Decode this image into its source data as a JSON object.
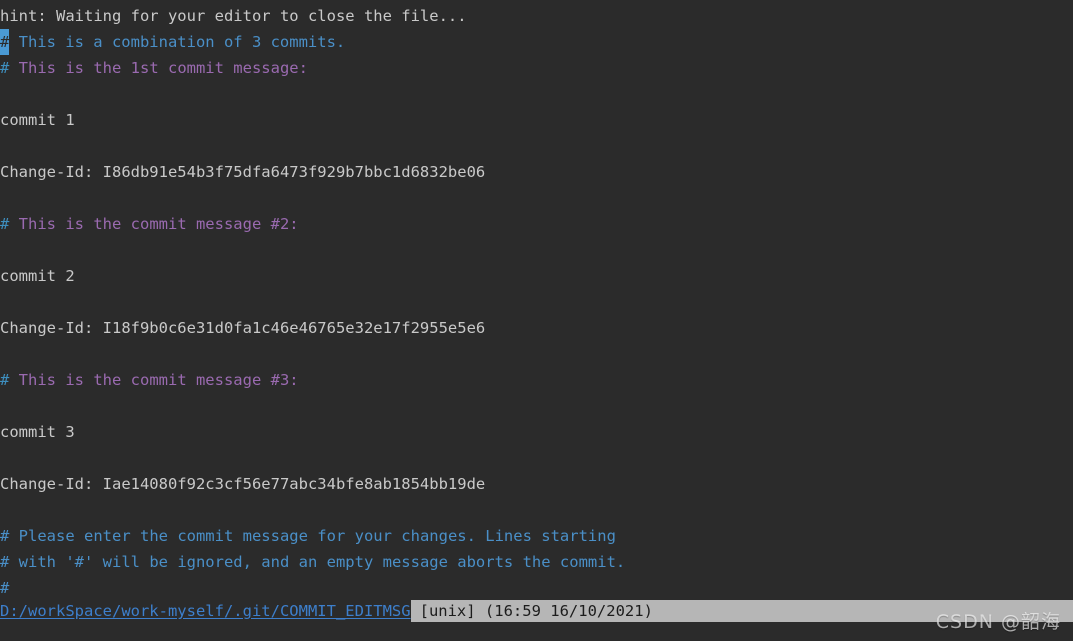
{
  "terminal": {
    "background": "#2b2b2b",
    "foreground": "#c9c9c9",
    "comment_blue": "#4a8fc7",
    "comment_purple": "#9a6ab0",
    "cursor_color": "#4a9ad4",
    "statusbar_background": "#b6b6b6",
    "filepath_color": "#3d7fcc"
  },
  "lines": [
    {
      "id": "hint",
      "kind": "hint",
      "text": "hint: Waiting for your editor to close the file..."
    },
    {
      "id": "combination",
      "kind": "comment-blue",
      "hash": "#",
      "text": " This is a combination of 3 commits.",
      "cursor": true
    },
    {
      "id": "msg1-header",
      "kind": "comment-purple",
      "hash": "#",
      "text": " This is the 1st commit message:"
    },
    {
      "id": "blank-1",
      "kind": "plain",
      "text": ""
    },
    {
      "id": "commit-1",
      "kind": "plain",
      "text": "commit 1"
    },
    {
      "id": "blank-2",
      "kind": "plain",
      "text": ""
    },
    {
      "id": "change-id-1",
      "kind": "plain",
      "text": "Change-Id: I86db91e54b3f75dfa6473f929b7bbc1d6832be06"
    },
    {
      "id": "blank-3",
      "kind": "plain",
      "text": ""
    },
    {
      "id": "msg2-header",
      "kind": "comment-purple",
      "hash": "#",
      "text": " This is the commit message #2:"
    },
    {
      "id": "blank-4",
      "kind": "plain",
      "text": ""
    },
    {
      "id": "commit-2",
      "kind": "plain",
      "text": "commit 2"
    },
    {
      "id": "blank-5",
      "kind": "plain",
      "text": ""
    },
    {
      "id": "change-id-2",
      "kind": "plain",
      "text": "Change-Id: I18f9b0c6e31d0fa1c46e46765e32e17f2955e5e6"
    },
    {
      "id": "blank-6",
      "kind": "plain",
      "text": ""
    },
    {
      "id": "msg3-header",
      "kind": "comment-purple",
      "hash": "#",
      "text": " This is the commit message #3:"
    },
    {
      "id": "blank-7",
      "kind": "plain",
      "text": ""
    },
    {
      "id": "commit-3",
      "kind": "plain",
      "text": "commit 3"
    },
    {
      "id": "blank-8",
      "kind": "plain",
      "text": ""
    },
    {
      "id": "change-id-3",
      "kind": "plain",
      "text": "Change-Id: Iae14080f92c3cf56e77abc34bfe8ab1854bb19de"
    },
    {
      "id": "blank-9",
      "kind": "plain",
      "text": ""
    },
    {
      "id": "help-1",
      "kind": "comment-blue",
      "hash": "#",
      "text": " Please enter the commit message for your changes. Lines starting"
    },
    {
      "id": "help-2",
      "kind": "comment-blue",
      "hash": "#",
      "text": " with '#' will be ignored, and an empty message aborts the commit."
    },
    {
      "id": "help-3",
      "kind": "comment-blue",
      "hash": "#",
      "text": ""
    }
  ],
  "statusbar": {
    "filepath": "D:/workSpace/work-myself/.git/COMMIT_EDITMSG",
    "meta": "[unix] (16:59 16/10/2021)"
  },
  "watermark": {
    "text": "CSDN @韶海"
  }
}
